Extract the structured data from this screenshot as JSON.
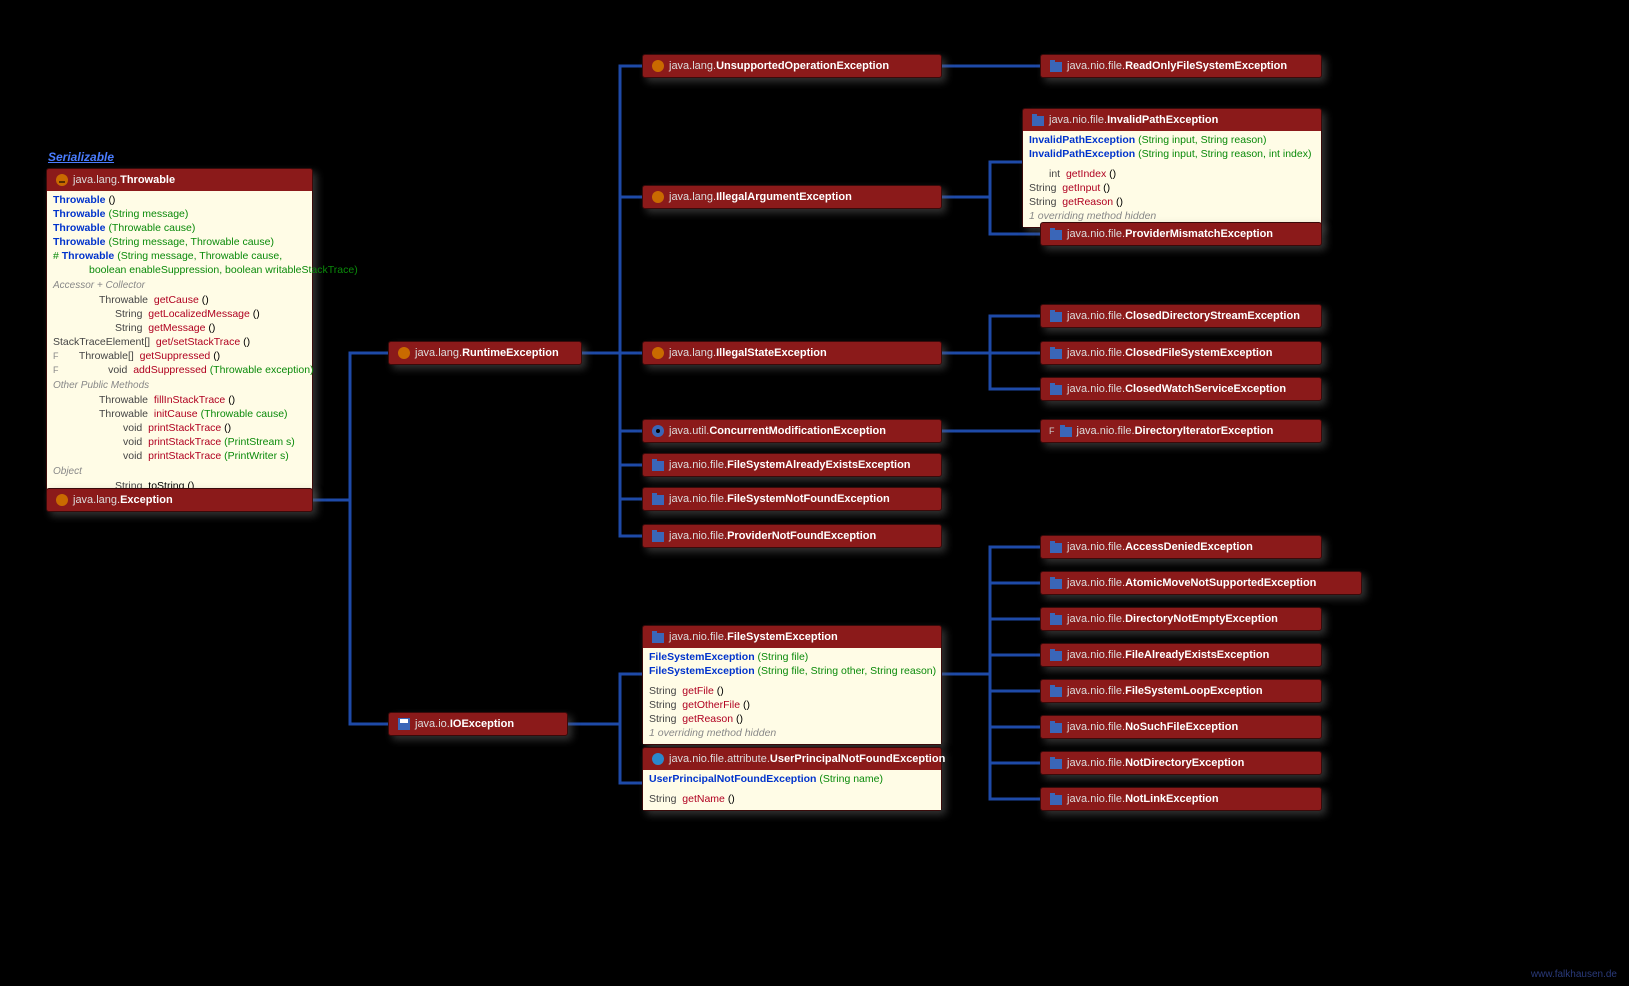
{
  "interface": "Serializable",
  "watermark": "www.falkhausen.de",
  "throwable": {
    "pkg": "java.lang.",
    "cls": "Throwable",
    "ctors": [
      {
        "name": "Throwable",
        "args": "()"
      },
      {
        "name": "Throwable",
        "args": "(String message)"
      },
      {
        "name": "Throwable",
        "args": "(Throwable cause)"
      },
      {
        "name": "Throwable",
        "args": "(String message, Throwable cause)"
      }
    ],
    "protCtor": {
      "marker": "#",
      "name": "Throwable",
      "args1": "(String message, Throwable cause,",
      "args2": "boolean enableSuppression, boolean writableStackTrace)"
    },
    "secAccessor": "Accessor + Collector",
    "accessor": [
      {
        "ret": "Throwable",
        "name": "getCause",
        "args": "()"
      },
      {
        "ret": "String",
        "name": "getLocalizedMessage",
        "args": "()"
      },
      {
        "ret": "String",
        "name": "getMessage",
        "args": "()"
      },
      {
        "ret": "StackTraceElement[]",
        "name": "get/setStackTrace",
        "args": "()"
      },
      {
        "marker": "F",
        "ret": "Throwable[]",
        "name": "getSuppressed",
        "args": "()"
      },
      {
        "marker": "F",
        "ret": "void",
        "name": "addSuppressed",
        "args": "(Throwable exception)"
      }
    ],
    "secOther": "Other Public Methods",
    "other": [
      {
        "ret": "Throwable",
        "name": "fillInStackTrace",
        "args": "()"
      },
      {
        "ret": "Throwable",
        "name": "initCause",
        "args": "(Throwable cause)"
      },
      {
        "ret": "void",
        "name": "printStackTrace",
        "args": "()"
      },
      {
        "ret": "void",
        "name": "printStackTrace",
        "args": "(PrintStream s)"
      },
      {
        "ret": "void",
        "name": "printStackTrace",
        "args": "(PrintWriter s)"
      }
    ],
    "secObject": "Object",
    "object": [
      {
        "ret": "String",
        "name": "toString",
        "args": "()"
      }
    ]
  },
  "nodes": {
    "exception": {
      "pkg": "java.lang.",
      "cls": "Exception",
      "icon": "class"
    },
    "runtime": {
      "pkg": "java.lang.",
      "cls": "RuntimeException",
      "icon": "class"
    },
    "ioexception": {
      "pkg": "java.io.",
      "cls": "IOException",
      "icon": "save"
    },
    "unsupportedOp": {
      "pkg": "java.lang.",
      "cls": "UnsupportedOperationException",
      "icon": "class"
    },
    "illegalArg": {
      "pkg": "java.lang.",
      "cls": "IllegalArgumentException",
      "icon": "class"
    },
    "illegalState": {
      "pkg": "java.lang.",
      "cls": "IllegalStateException",
      "icon": "class"
    },
    "concurrentMod": {
      "pkg": "java.util.",
      "cls": "ConcurrentModificationException",
      "icon": "gear"
    },
    "fsAlready": {
      "pkg": "java.nio.file.",
      "cls": "FileSystemAlreadyExistsException",
      "icon": "pkg"
    },
    "fsNotFound": {
      "pkg": "java.nio.file.",
      "cls": "FileSystemNotFoundException",
      "icon": "pkg"
    },
    "providerNotFound": {
      "pkg": "java.nio.file.",
      "cls": "ProviderNotFoundException",
      "icon": "pkg"
    },
    "readOnlyFS": {
      "pkg": "java.nio.file.",
      "cls": "ReadOnlyFileSystemException",
      "icon": "pkg"
    },
    "providerMismatch": {
      "pkg": "java.nio.file.",
      "cls": "ProviderMismatchException",
      "icon": "pkg"
    },
    "closedDirStream": {
      "pkg": "java.nio.file.",
      "cls": "ClosedDirectoryStreamException",
      "icon": "pkg"
    },
    "closedFS": {
      "pkg": "java.nio.file.",
      "cls": "ClosedFileSystemException",
      "icon": "pkg"
    },
    "closedWatch": {
      "pkg": "java.nio.file.",
      "cls": "ClosedWatchServiceException",
      "icon": "pkg"
    },
    "dirIterator": {
      "marker": "F",
      "pkg": "java.nio.file.",
      "cls": "DirectoryIteratorException",
      "icon": "pkg"
    },
    "accessDenied": {
      "pkg": "java.nio.file.",
      "cls": "AccessDeniedException",
      "icon": "pkg"
    },
    "atomicMove": {
      "pkg": "java.nio.file.",
      "cls": "AtomicMoveNotSupportedException",
      "icon": "pkg"
    },
    "dirNotEmpty": {
      "pkg": "java.nio.file.",
      "cls": "DirectoryNotEmptyException",
      "icon": "pkg"
    },
    "fileAlready": {
      "pkg": "java.nio.file.",
      "cls": "FileAlreadyExistsException",
      "icon": "pkg"
    },
    "fsLoop": {
      "pkg": "java.nio.file.",
      "cls": "FileSystemLoopException",
      "icon": "pkg"
    },
    "noSuchFile": {
      "pkg": "java.nio.file.",
      "cls": "NoSuchFileException",
      "icon": "pkg"
    },
    "notDir": {
      "pkg": "java.nio.file.",
      "cls": "NotDirectoryException",
      "icon": "pkg"
    },
    "notLink": {
      "pkg": "java.nio.file.",
      "cls": "NotLinkException",
      "icon": "pkg"
    }
  },
  "invalidPath": {
    "pkg": "java.nio.file.",
    "cls": "InvalidPathException",
    "ctors": [
      {
        "name": "InvalidPathException",
        "args": "(String input, String reason)"
      },
      {
        "name": "InvalidPathException",
        "args": "(String input, String reason, int index)"
      }
    ],
    "members": [
      {
        "ret": "int",
        "name": "getIndex",
        "args": "()"
      },
      {
        "ret": "String",
        "name": "getInput",
        "args": "()"
      },
      {
        "ret": "String",
        "name": "getReason",
        "args": "()"
      }
    ],
    "note": "1 overriding method hidden"
  },
  "fsException": {
    "pkg": "java.nio.file.",
    "cls": "FileSystemException",
    "ctors": [
      {
        "name": "FileSystemException",
        "args": "(String file)"
      },
      {
        "name": "FileSystemException",
        "args": "(String file, String other, String reason)"
      }
    ],
    "members": [
      {
        "ret": "String",
        "name": "getFile",
        "args": "()"
      },
      {
        "ret": "String",
        "name": "getOtherFile",
        "args": "()"
      },
      {
        "ret": "String",
        "name": "getReason",
        "args": "()"
      }
    ],
    "note": "1 overriding method hidden"
  },
  "userPrincipal": {
    "pkg": "java.nio.file.attribute.",
    "cls": "UserPrincipalNotFoundException",
    "ctors": [
      {
        "name": "UserPrincipalNotFoundException",
        "args": "(String name)"
      }
    ],
    "members": [
      {
        "ret": "String",
        "name": "getName",
        "args": "()"
      }
    ]
  }
}
